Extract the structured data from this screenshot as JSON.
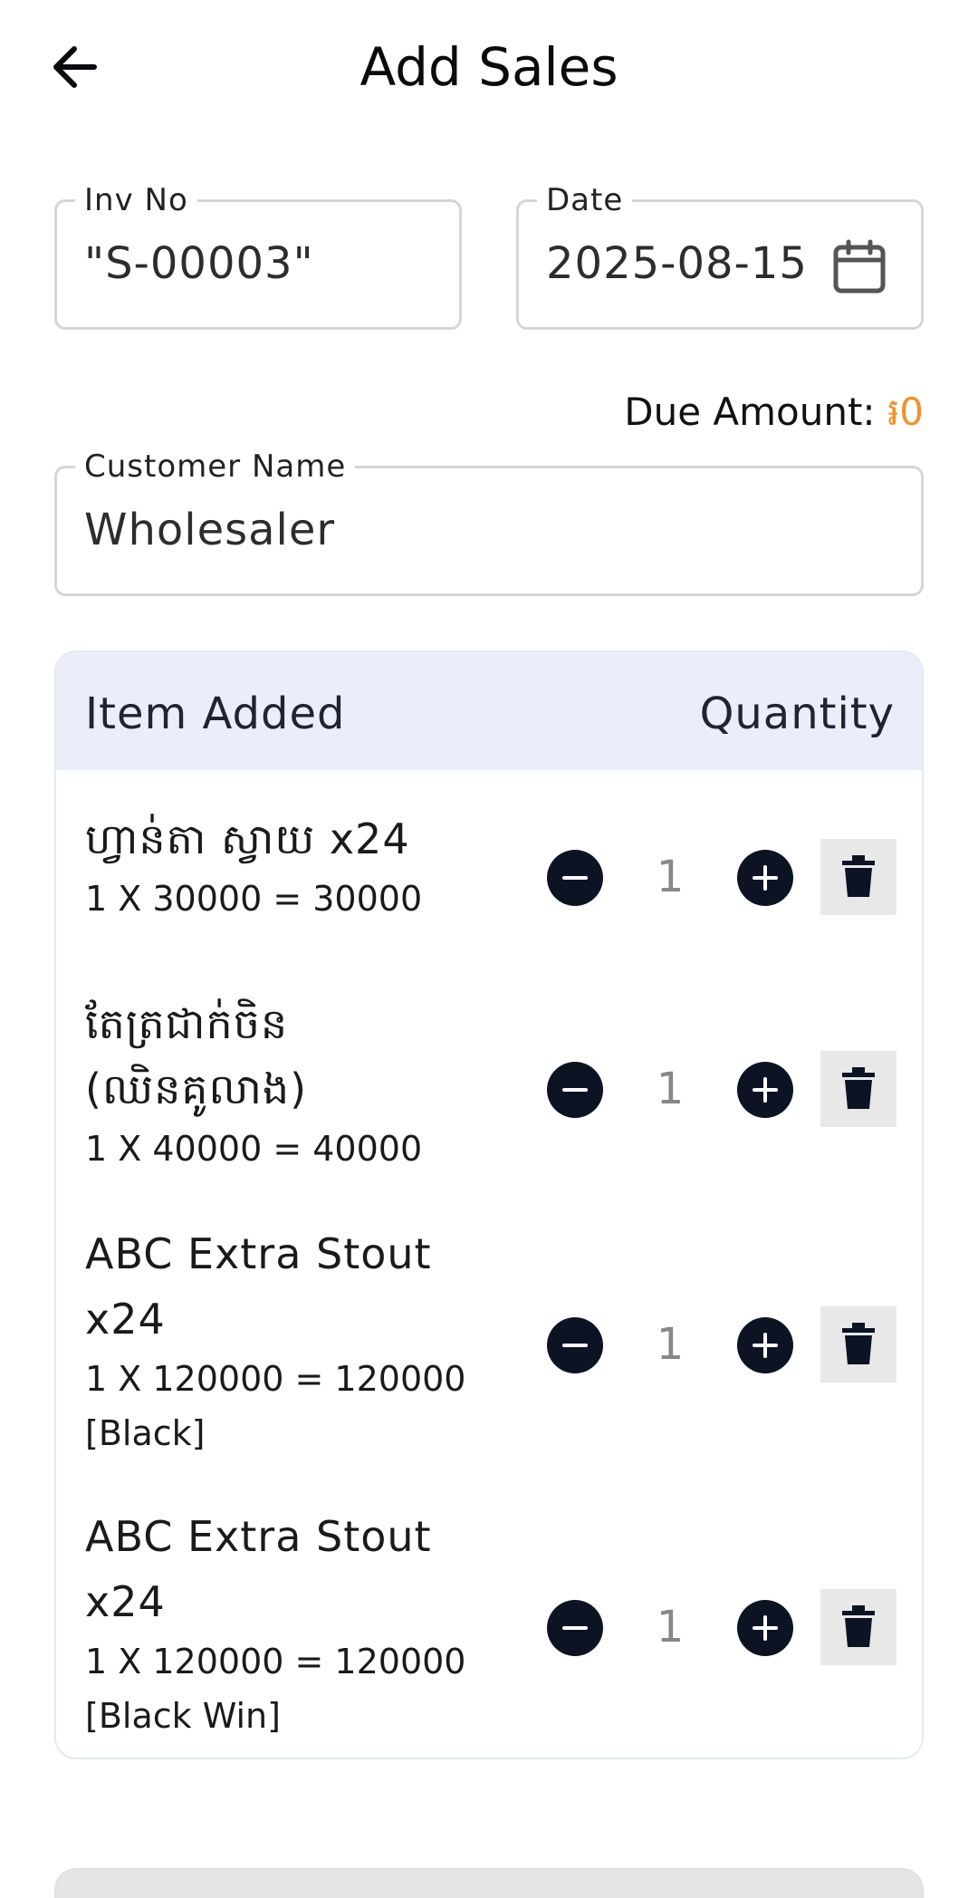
{
  "header": {
    "title": "Add Sales",
    "back_icon": "arrow-left-icon"
  },
  "invoice": {
    "label": "Inv No",
    "value": "\"S-00003\""
  },
  "date": {
    "label": "Date",
    "value": "2025-08-15",
    "icon": "calendar-icon"
  },
  "due": {
    "label": "Due Amount: ",
    "amount": "៛0",
    "amount_color": "#f0922c"
  },
  "customer": {
    "label": "Customer Name",
    "value": "Wholesaler"
  },
  "items_table": {
    "col_item": "Item Added",
    "col_qty": "Quantity",
    "rows": [
      {
        "name": "ហ្វាន់តា ស្វាយ x24",
        "calc": "1 X 30000 = 30000",
        "variant": "",
        "qty": "1"
      },
      {
        "name": "តែត្រជាក់ចិន (ឈិនគូលាង)",
        "calc": "1 X 40000 = 40000",
        "variant": "",
        "qty": "1"
      },
      {
        "name": "ABC Extra Stout x24",
        "calc": "1 X 120000 = 120000",
        "variant": "[Black]",
        "qty": "1"
      },
      {
        "name": "ABC Extra Stout x24",
        "calc": "1 X 120000 = 120000",
        "variant": "[Black Win]",
        "qty": "1"
      }
    ]
  },
  "colors": {
    "accent_dark": "#0c1424",
    "header_bg": "#eaeefa"
  }
}
